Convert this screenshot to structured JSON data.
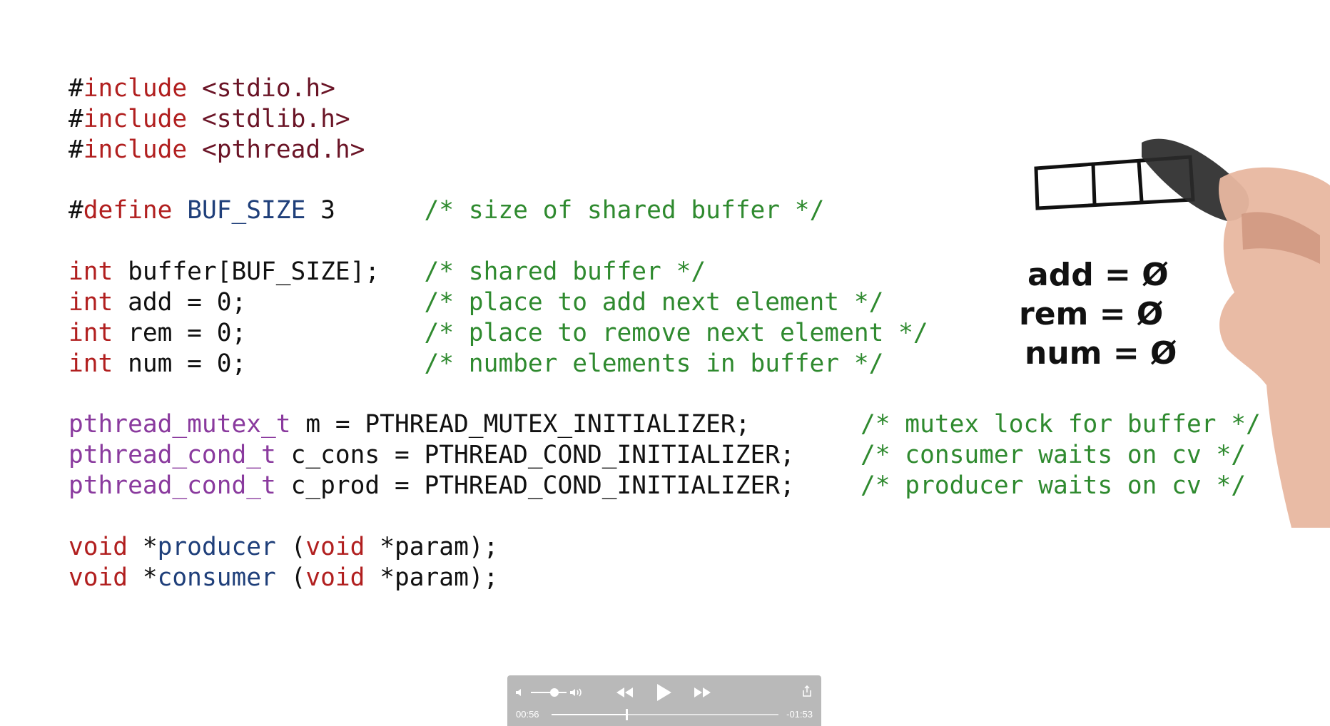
{
  "code": {
    "lines": [
      [
        {
          "t": "#",
          "c": "pl"
        },
        {
          "t": "include",
          "c": "kw"
        },
        {
          "t": " ",
          "c": "pl"
        },
        {
          "t": "<stdio.h>",
          "c": "hdr"
        }
      ],
      [
        {
          "t": "#",
          "c": "pl"
        },
        {
          "t": "include",
          "c": "kw"
        },
        {
          "t": " ",
          "c": "pl"
        },
        {
          "t": "<stdlib.h>",
          "c": "hdr"
        }
      ],
      [
        {
          "t": "#",
          "c": "pl"
        },
        {
          "t": "include",
          "c": "kw"
        },
        {
          "t": " ",
          "c": "pl"
        },
        {
          "t": "<pthread.h>",
          "c": "hdr"
        }
      ],
      [],
      [
        {
          "t": "#",
          "c": "pl"
        },
        {
          "t": "define",
          "c": "kw"
        },
        {
          "t": " ",
          "c": "pl"
        },
        {
          "t": "BUF_SIZE",
          "c": "fn"
        },
        {
          "t": " 3      ",
          "c": "pl"
        },
        {
          "t": "/* size of shared buffer */",
          "c": "cm"
        }
      ],
      [],
      [
        {
          "t": "int",
          "c": "kw"
        },
        {
          "t": " buffer[BUF_SIZE];   ",
          "c": "pl"
        },
        {
          "t": "/* shared buffer */",
          "c": "cm"
        }
      ],
      [
        {
          "t": "int",
          "c": "kw"
        },
        {
          "t": " add = 0;            ",
          "c": "pl"
        },
        {
          "t": "/* place to add next element */",
          "c": "cm"
        }
      ],
      [
        {
          "t": "int",
          "c": "kw"
        },
        {
          "t": " rem = 0;            ",
          "c": "pl"
        },
        {
          "t": "/* place to remove next element */",
          "c": "cm"
        }
      ],
      [
        {
          "t": "int",
          "c": "kw"
        },
        {
          "t": " num = 0;            ",
          "c": "pl"
        },
        {
          "t": "/* number elements in buffer */",
          "c": "cm"
        }
      ],
      [],
      [
        {
          "t": "pthread_mutex_t",
          "c": "ty"
        },
        {
          "t": " m = PTHREAD_MUTEX_INITIALIZER;",
          "c": "pl"
        }
      ],
      [
        {
          "t": "pthread_cond_t",
          "c": "ty"
        },
        {
          "t": " c_cons = PTHREAD_COND_INITIALIZER;",
          "c": "pl"
        }
      ],
      [
        {
          "t": "pthread_cond_t",
          "c": "ty"
        },
        {
          "t": " c_prod = PTHREAD_COND_INITIALIZER;",
          "c": "pl"
        }
      ],
      [],
      [
        {
          "t": "void",
          "c": "kw"
        },
        {
          "t": " *",
          "c": "pl"
        },
        {
          "t": "producer",
          "c": "fn"
        },
        {
          "t": " (",
          "c": "pl"
        },
        {
          "t": "void",
          "c": "kw"
        },
        {
          "t": " *param);",
          "c": "pl"
        }
      ],
      [
        {
          "t": "void",
          "c": "kw"
        },
        {
          "t": " *",
          "c": "pl"
        },
        {
          "t": "consumer",
          "c": "fn"
        },
        {
          "t": " (",
          "c": "pl"
        },
        {
          "t": "void",
          "c": "kw"
        },
        {
          "t": " *param);",
          "c": "pl"
        }
      ]
    ],
    "pthread_comments": [
      {
        "line": 11,
        "text": "/* mutex lock for buffer */"
      },
      {
        "line": 12,
        "text": "/* consumer waits on cv */"
      },
      {
        "line": 13,
        "text": "/* producer waits on cv */"
      }
    ]
  },
  "drawing": {
    "buffer_slots": 3,
    "labels": [
      "add = Ø",
      "rem = Ø",
      "num = Ø"
    ]
  },
  "player": {
    "elapsed": "00:56",
    "remaining": "-01:53",
    "progress_fraction": 0.33,
    "volume_fraction": 0.65,
    "icons": [
      "volume-low-icon",
      "volume-high-icon",
      "rewind-icon",
      "play-icon",
      "fast-forward-icon",
      "share-icon"
    ],
    "colors": {
      "bar": "#b9b9b9",
      "foreground": "#ffffff"
    }
  }
}
